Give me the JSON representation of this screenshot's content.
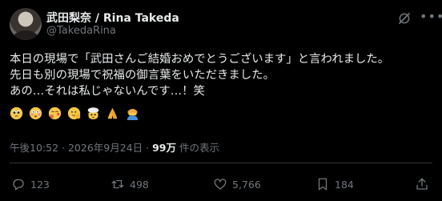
{
  "author": {
    "display_name": "武田梨奈 / Rina Takeda",
    "handle": "@TakedaRina"
  },
  "tweet": {
    "lines": [
      "本日の現場で「武田さんご結婚おめでとうございます」と言われました。",
      "先日も別の現場で祝福の御言葉をいただきました。",
      "あの…それは私じゃないんです…！笑"
    ],
    "emojis": [
      "pleading-face",
      "flushed-face",
      "face-blowing-kiss",
      "person-raising-hand",
      "exploding-head",
      "folded-hands",
      "person-bowing"
    ]
  },
  "meta": {
    "time": "午後10:52",
    "separator": "·",
    "date": "2026年9月24日",
    "views": "99万",
    "views_suffix": "件の表示"
  },
  "actions": {
    "replies": "123",
    "reposts": "498",
    "likes": "5,766",
    "bookmarks": "184"
  },
  "colors": {
    "background": "#000000",
    "text": "#e7e9ea",
    "muted": "#71767b",
    "divider": "#2f3336"
  }
}
